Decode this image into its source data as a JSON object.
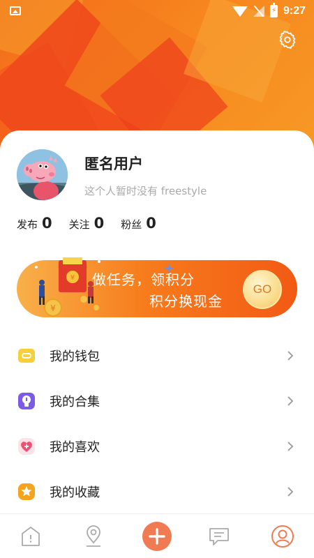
{
  "status_bar": {
    "time": "9:27"
  },
  "profile": {
    "name": "匿名用户",
    "bio": "这个人暂时没有 freestyle"
  },
  "stats": [
    {
      "label": "发布",
      "value": "0"
    },
    {
      "label": "关注",
      "value": "0"
    },
    {
      "label": "粉丝",
      "value": "0"
    }
  ],
  "banner": {
    "line1": "做任务，领积分",
    "line2": "积分换现金",
    "button": "GO"
  },
  "menu": [
    {
      "label": "我的钱包",
      "icon": "wallet-icon",
      "color": "#f7cf3a"
    },
    {
      "label": "我的合集",
      "icon": "collection-icon",
      "color": "#7b5be6"
    },
    {
      "label": "我的喜欢",
      "icon": "heart-icon",
      "color": "#f05072"
    },
    {
      "label": "我的收藏",
      "icon": "star-icon",
      "color": "#f5a41c"
    }
  ],
  "tabbar": [
    {
      "icon": "home-icon"
    },
    {
      "icon": "location-icon"
    },
    {
      "icon": "add-icon"
    },
    {
      "icon": "message-icon"
    },
    {
      "icon": "profile-icon"
    }
  ],
  "colors": {
    "accent": "#f07a3a",
    "banner_start": "#f8b04a",
    "banner_end": "#f25a14"
  }
}
